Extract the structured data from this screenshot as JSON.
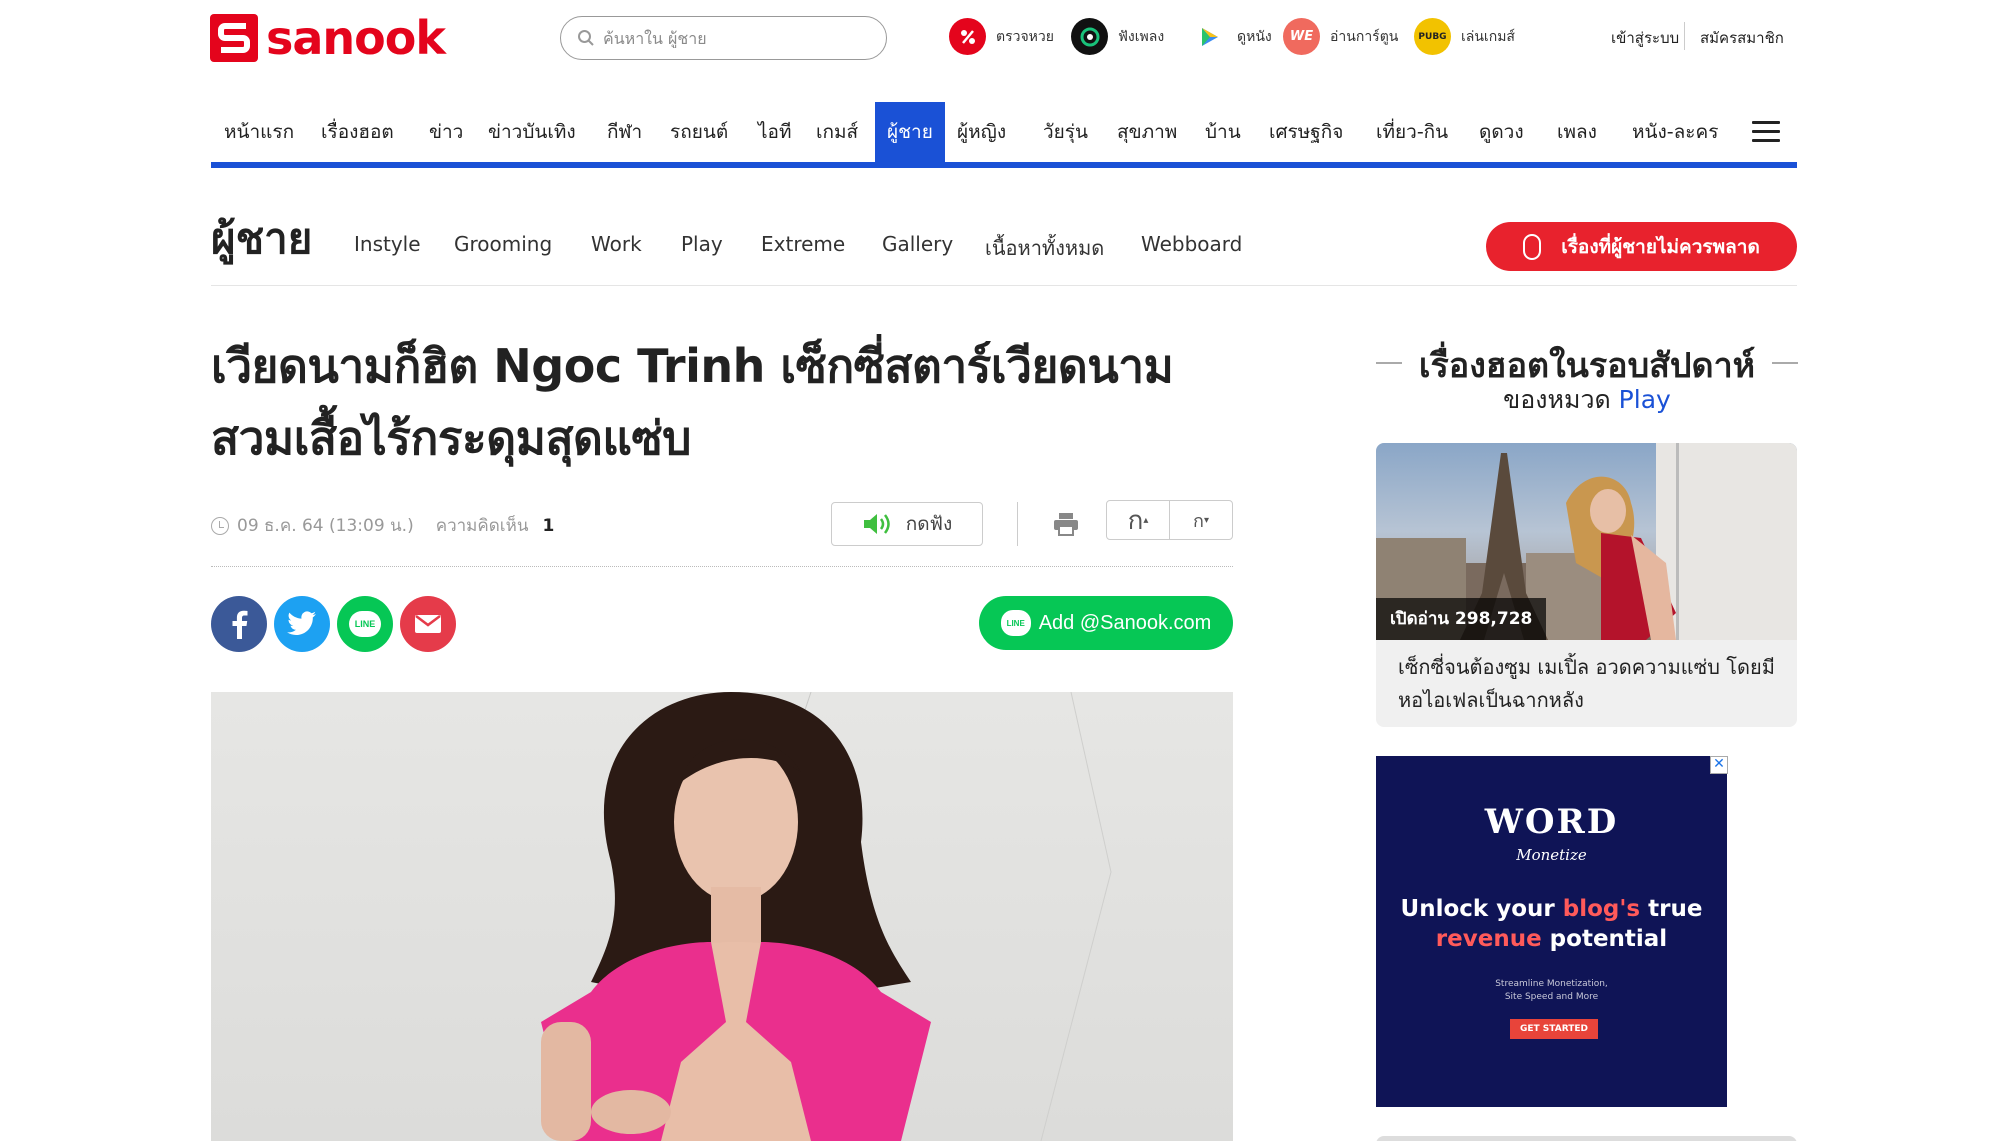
{
  "header": {
    "logo_text": "sanook",
    "search": {
      "placeholder": "ค้นหาใน ผู้ชาย"
    },
    "quick_links": [
      {
        "label": "ตรวจหวย",
        "icon": "lottery-icon",
        "color": "#e4041c"
      },
      {
        "label": "ฟังเพลง",
        "icon": "music-icon",
        "color": "#111111"
      },
      {
        "label": "ดูหนัง",
        "icon": "play-icon",
        "color": "#ffffff"
      },
      {
        "label": "อ่านการ์ตูน",
        "icon": "comics-icon",
        "color": "#f06a5e"
      },
      {
        "label": "เล่นเกมส์",
        "icon": "game-icon",
        "color": "#f2c200"
      }
    ],
    "login_label": "เข้าสู่ระบบ",
    "register_label": "สมัครสมาชิก"
  },
  "main_nav": {
    "items": [
      "หน้าแรก",
      "เรื่องฮอต",
      "ข่าว",
      "ข่าวบันเทิง",
      "กีฬา",
      "รถยนต์",
      "ไอที",
      "เกมส์",
      "ผู้ชาย",
      "ผู้หญิง",
      "วัยรุ่น",
      "สุขภาพ",
      "บ้าน",
      "เศรษฐกิจ",
      "เที่ยว-กิน",
      "ดูดวง",
      "เพลง",
      "หนัง-ละคร"
    ],
    "active": "ผู้ชาย",
    "accent_color": "#1a51d6"
  },
  "sub_nav": {
    "title": "ผู้ชาย",
    "items": [
      "Instyle",
      "Grooming",
      "Work",
      "Play",
      "Extreme",
      "Gallery",
      "เนื้อหาทั้งหมด",
      "Webboard"
    ],
    "cta_label": "เรื่องที่ผู้ชายไม่ควรพลาด",
    "cta_color": "#e8222d"
  },
  "article": {
    "headline_line1": "เวียดนามก็ฮิต Ngoc Trinh เซ็กซี่สตาร์เวียดนาม",
    "headline_line2": "สวมเสื้อไร้กระดุมสุดแซ่บ",
    "date": "09 ธ.ค. 64 (13:09 น.)",
    "comments_label": "ความคิดเห็น",
    "comments_count": "1",
    "listen_label": "กดฟัง",
    "font_larger": "ก",
    "font_smaller": "ก",
    "add_line_label": "Add @Sanook.com",
    "line_badge": "LINE",
    "line_color": "#06c755"
  },
  "sidebar": {
    "title": "เรื่องฮอตในรอบสัปดาห์",
    "subtitle_prefix": "ของหมวด",
    "subtitle_category": "Play",
    "card": {
      "views": "เปิดอ่าน 298,728",
      "title": "เซ็กซี่จนต้องซูม เมเปิ้ล อวดความแซ่บ โดยมีหอไอเฟลเป็นฉากหลัง"
    },
    "ad": {
      "brand": "WORD",
      "brand_sub": "Monetize",
      "headline_a": "Unlock your ",
      "headline_hl1": "blog's",
      "headline_b": " true",
      "headline_hl2": "revenue",
      "headline_c": " potential",
      "small_1": "Streamline Monetization,",
      "small_2": "Site Speed and More",
      "button": "GET STARTED",
      "close": "✕"
    }
  }
}
